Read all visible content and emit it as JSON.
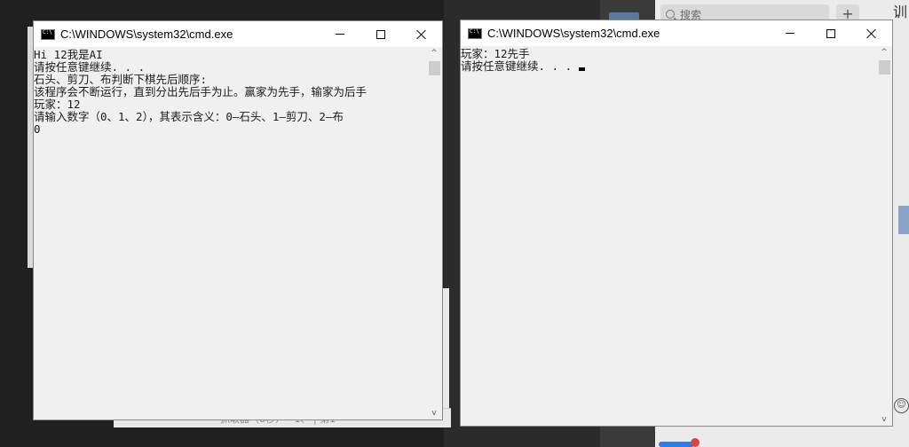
{
  "chat": {
    "search_placeholder": "搜索",
    "plus_label": "+",
    "title_partial": "训"
  },
  "left_window": {
    "title": "C:\\WINDOWS\\system32\\cmd.exe",
    "lines": [
      "Hi 12我是AI",
      "请按任意键继续. . .",
      "石头、剪刀、布判断下棋先后顺序:",
      "该程序会不断运行，直到分出先后手为止。赢家为先手，输家为后手",
      "玩家：12",
      "请输入数字（0、1、2），其表示含义：0—石头、1—剪刀、2—布",
      "0"
    ]
  },
  "right_window": {
    "title": "C:\\WINDOWS\\system32\\cmd.exe",
    "lines": [
      "玩家：12先手",
      "请按任意键继续. . . "
    ]
  },
  "behind_window": {
    "text": "抓取器（8秒）  ·  1、  |  第1  "
  },
  "icons": {
    "min": "minimize-icon",
    "max": "maximize-icon",
    "close": "close-icon"
  }
}
